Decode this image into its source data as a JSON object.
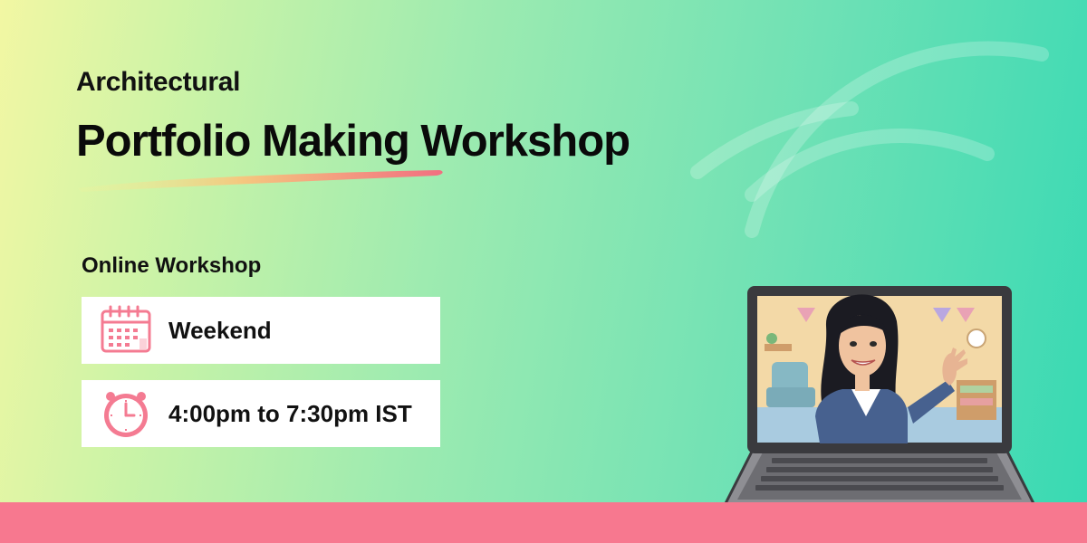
{
  "eyebrow": "Architectural",
  "headline": "Portfolio Making Workshop",
  "subtitle": "Online Workshop",
  "cards": [
    {
      "icon": "calendar-icon",
      "text": "Weekend"
    },
    {
      "icon": "clock-icon",
      "text": "4:00pm to 7:30pm IST"
    }
  ],
  "colors": {
    "accent_pink": "#f7788f",
    "gradient_start": "#f2f7a3",
    "gradient_end": "#37d9b3",
    "text": "#111111"
  }
}
